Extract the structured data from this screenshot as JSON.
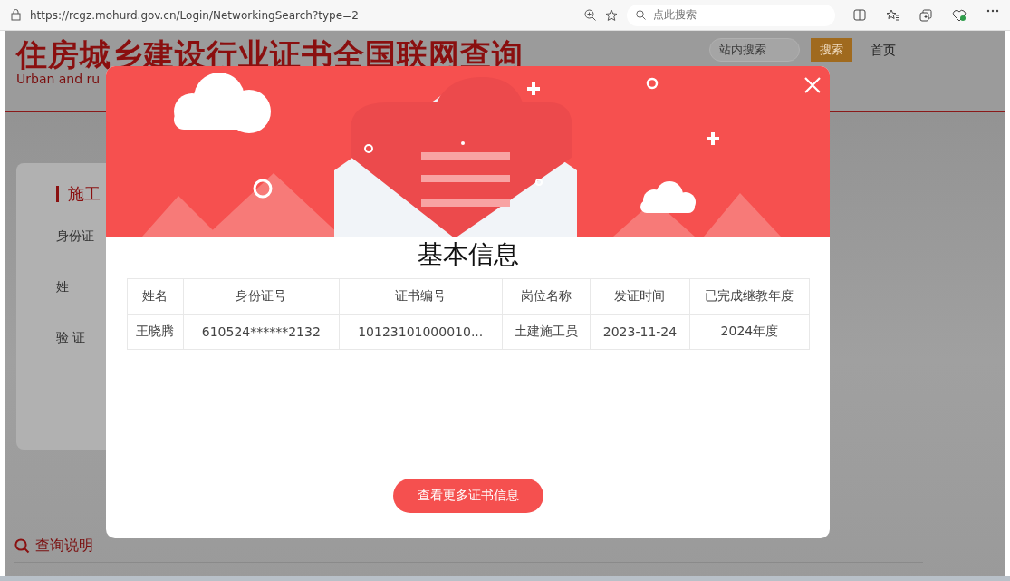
{
  "browser": {
    "url": "https://rcgz.mohurd.gov.cn/Login/NetworkingSearch?type=2",
    "search_placeholder": "点此搜索"
  },
  "site": {
    "title": "住房城乡建设行业证书全国联网查询",
    "subtitle": "Urban and ru",
    "search_placeholder": "站内搜索",
    "search_button": "搜索",
    "nav": [
      "首页"
    ]
  },
  "form": {
    "heading": "施工",
    "fields": [
      "身份证",
      "姓",
      "验 证"
    ]
  },
  "help": {
    "label": "查询说明"
  },
  "modal": {
    "title": "基本信息",
    "columns": [
      "姓名",
      "身份证号",
      "证书编号",
      "岗位名称",
      "发证时间",
      "已完成继教年度"
    ],
    "rows": [
      [
        "王晓腾",
        "610524******2132",
        "10123101000010...",
        "土建施工员",
        "2023-11-24",
        "2024年度"
      ]
    ],
    "button": "查看更多证书信息"
  }
}
